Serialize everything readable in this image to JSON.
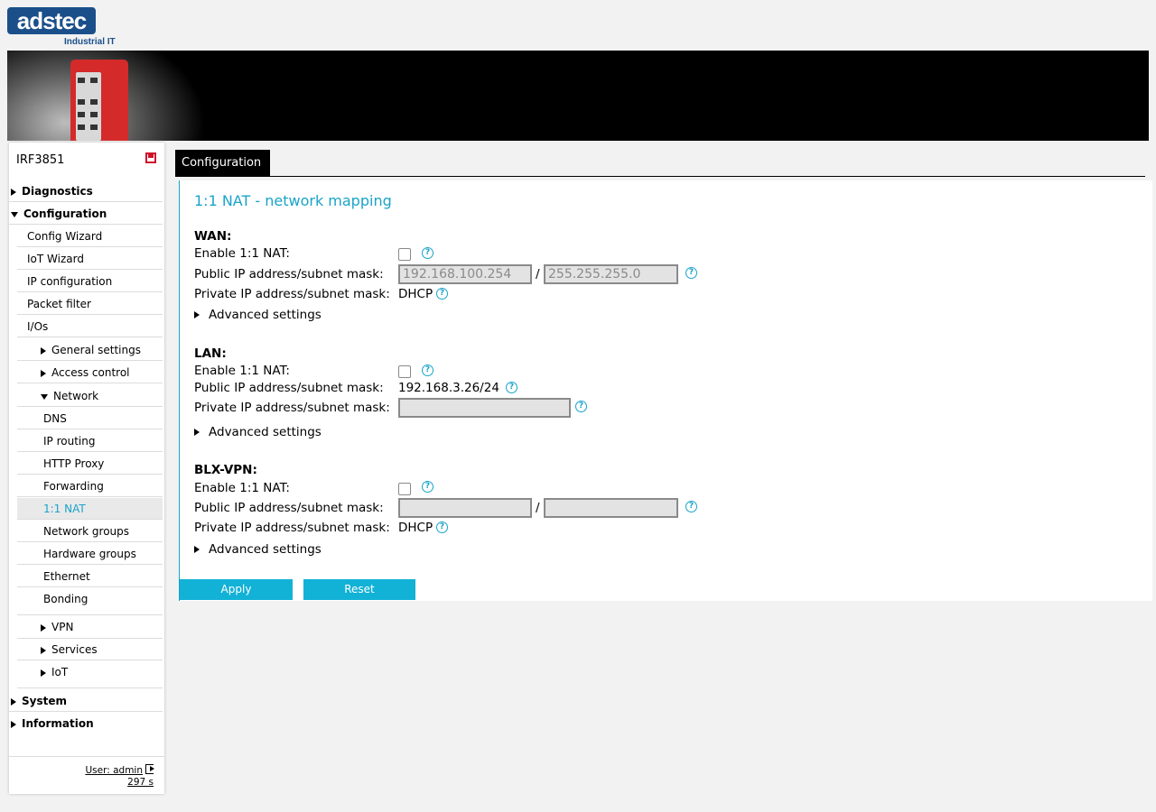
{
  "brand": {
    "logo_text": "adstec",
    "logo_sub": "Industrial IT"
  },
  "device_name": "IRF3851",
  "tab": {
    "label": "Configuration"
  },
  "sidebar": {
    "items": [
      {
        "label": "Diagnostics"
      },
      {
        "label": "Configuration"
      },
      {
        "label": "Config Wizard"
      },
      {
        "label": "IoT Wizard"
      },
      {
        "label": "IP configuration"
      },
      {
        "label": "Packet filter"
      },
      {
        "label": "I/Os"
      },
      {
        "label": "General settings"
      },
      {
        "label": "Access control"
      },
      {
        "label": "Network"
      },
      {
        "label": "DNS"
      },
      {
        "label": "IP routing"
      },
      {
        "label": "HTTP Proxy"
      },
      {
        "label": "Forwarding"
      },
      {
        "label": "1:1 NAT"
      },
      {
        "label": "Network groups"
      },
      {
        "label": "Hardware groups"
      },
      {
        "label": "Ethernet"
      },
      {
        "label": "Bonding"
      },
      {
        "label": "VPN"
      },
      {
        "label": "Services"
      },
      {
        "label": "IoT"
      },
      {
        "label": "System"
      },
      {
        "label": "Information"
      }
    ],
    "user": "User: admin",
    "timer": "297 s"
  },
  "page": {
    "title": "1:1 NAT - network mapping",
    "wan": {
      "heading": "WAN:",
      "enable_label": "Enable 1:1 NAT:",
      "public_label": "Public IP address/subnet mask:",
      "public_ip_placeholder": "192.168.100.254",
      "public_mask_placeholder": "255.255.255.0",
      "slash": "/",
      "private_label": "Private IP address/subnet mask:",
      "private_value": "DHCP",
      "advanced": "Advanced settings"
    },
    "lan": {
      "heading": "LAN:",
      "enable_label": "Enable 1:1 NAT:",
      "public_label": "Public IP address/subnet mask:",
      "public_value": "192.168.3.26/24",
      "private_label": "Private IP address/subnet mask:",
      "private_placeholder": "",
      "advanced": "Advanced settings"
    },
    "blx": {
      "heading": "BLX-VPN:",
      "enable_label": "Enable 1:1 NAT:",
      "public_label": "Public IP address/subnet mask:",
      "slash": "/",
      "private_label": "Private IP address/subnet mask:",
      "private_value": "DHCP",
      "advanced": "Advanced settings"
    },
    "apply_label": "Apply",
    "reset_label": "Reset"
  },
  "help_glyph": "?",
  "colors": {
    "accent": "#1aa3c9",
    "button": "#12b1d6",
    "banner": "#000000",
    "device": "#d42a2a"
  }
}
